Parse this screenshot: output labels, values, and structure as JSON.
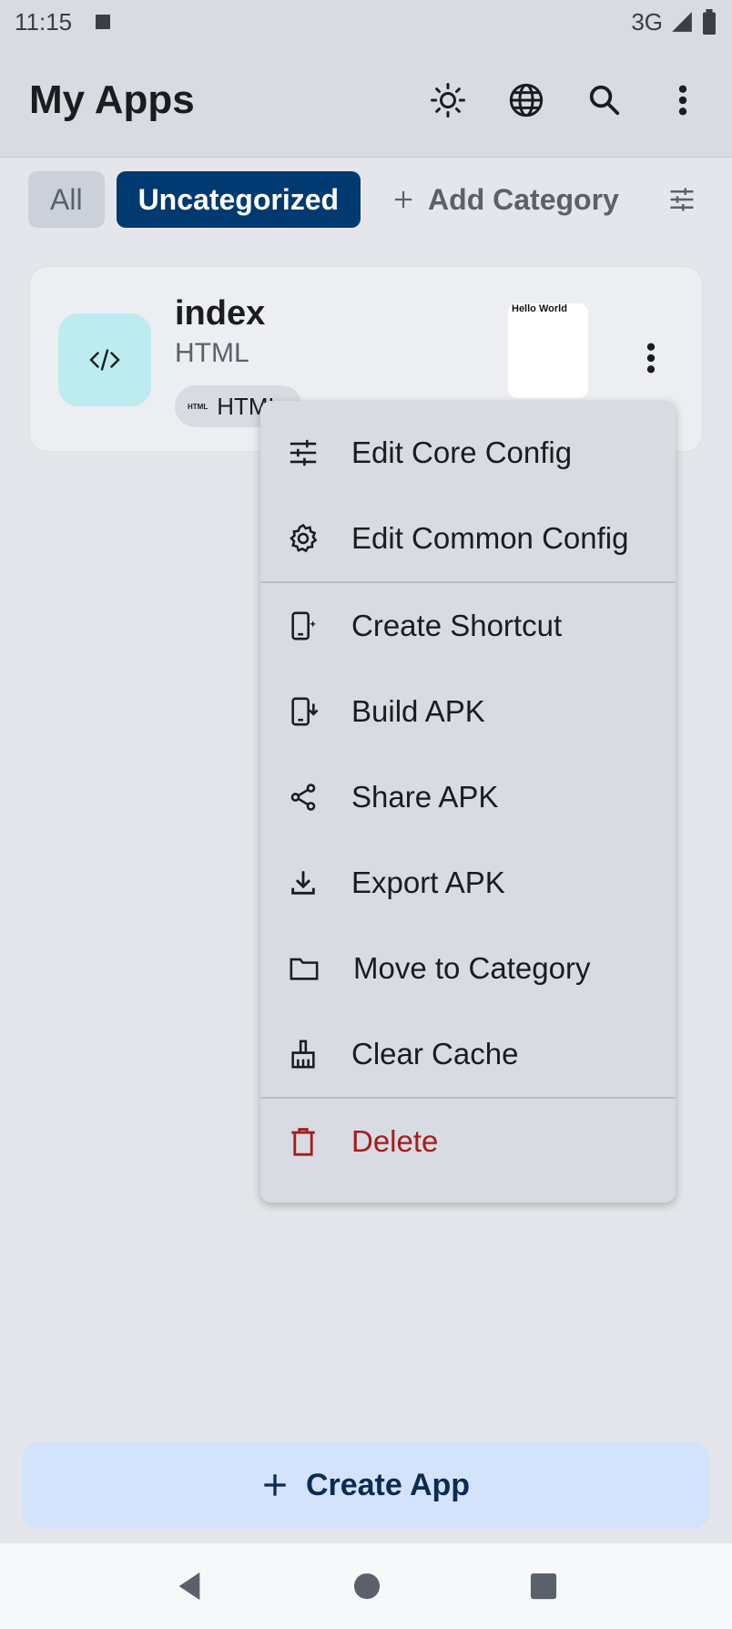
{
  "status_bar": {
    "time": "11:15",
    "network": "3G"
  },
  "app_bar": {
    "title": "My Apps",
    "actions": [
      "brightness-icon",
      "globe-icon",
      "search-icon",
      "more-vert-icon"
    ]
  },
  "categories": {
    "all_label": "All",
    "selected_label": "Uncategorized",
    "add_label": "Add Category"
  },
  "app_card": {
    "name": "index",
    "type": "HTML",
    "tag_mini": "HTML",
    "tag_label": "HTML",
    "preview_text": "Hello World"
  },
  "menu": {
    "items": [
      {
        "label": "Edit Core Config",
        "icon": "tune-icon"
      },
      {
        "label": "Edit Common Config",
        "icon": "gear-icon"
      },
      {
        "label": "Create Shortcut",
        "icon": "add-shortcut-icon"
      },
      {
        "label": "Build APK",
        "icon": "build-apk-icon"
      },
      {
        "label": "Share APK",
        "icon": "share-icon"
      },
      {
        "label": "Export APK",
        "icon": "download-icon"
      },
      {
        "label": "Move to Category",
        "icon": "folder-icon"
      },
      {
        "label": "Clear Cache",
        "icon": "broom-icon"
      },
      {
        "label": "Delete",
        "icon": "trash-icon"
      }
    ]
  },
  "create_button": {
    "label": "Create App"
  },
  "colors": {
    "selected_chip": "#003a70",
    "danger": "#a51c1c",
    "create_button_bg": "#d3e3fb",
    "card_icon_bg": "#bcecf0"
  }
}
